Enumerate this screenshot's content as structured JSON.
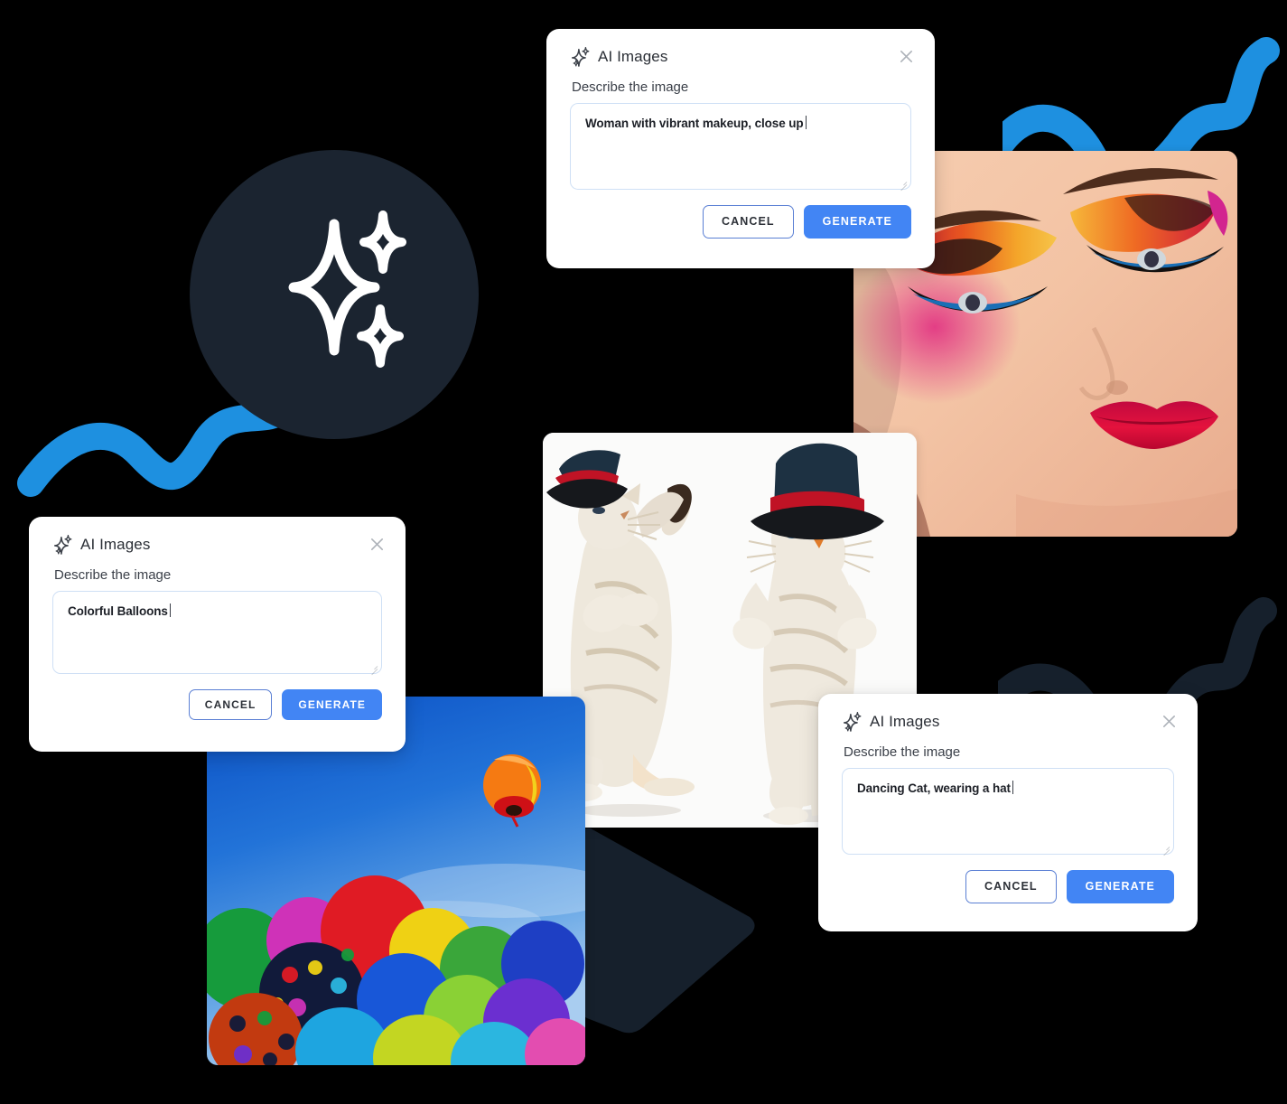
{
  "brand": {
    "accent_blue": "#4285f4",
    "squiggle_blue": "#1e90e0",
    "dark_navy": "#1b2430",
    "icon_name": "sparkles-icon"
  },
  "dialogs": [
    {
      "id": "makeup",
      "title": "AI Images",
      "label": "Describe the image",
      "prompt_value": "Woman with vibrant makeup, close up",
      "prompt_placeholder": "Describe the image",
      "cancel_label": "CANCEL",
      "generate_label": "GENERATE",
      "close_icon": "close-icon",
      "title_icon": "sparkles-icon"
    },
    {
      "id": "balloons",
      "title": "AI Images",
      "label": "Describe the image",
      "prompt_value": "Colorful Balloons",
      "prompt_placeholder": "Describe the image",
      "cancel_label": "CANCEL",
      "generate_label": "GENERATE",
      "close_icon": "close-icon",
      "title_icon": "sparkles-icon"
    },
    {
      "id": "cat",
      "title": "AI Images",
      "label": "Describe the image",
      "prompt_value": "Dancing Cat, wearing a hat",
      "prompt_placeholder": "Describe the image",
      "cancel_label": "CANCEL",
      "generate_label": "GENERATE",
      "close_icon": "close-icon",
      "title_icon": "sparkles-icon"
    }
  ],
  "images": [
    {
      "id": "makeup",
      "alt": "Close-up of a woman with vibrant multicolor eye makeup and red lips"
    },
    {
      "id": "cats",
      "alt": "Two dancing cats wearing top hats on a white background"
    },
    {
      "id": "balloons",
      "alt": "Colorful balloons floating against a blue sky"
    }
  ],
  "decor": {
    "circle_badge": "sparkles-badge",
    "blue_wave_left": "blue-wave-decoration",
    "blue_wave_top_right": "blue-wave-decoration",
    "dark_wave_right": "dark-wave-decoration",
    "dark_arrow": "dark-arrow-decoration"
  }
}
